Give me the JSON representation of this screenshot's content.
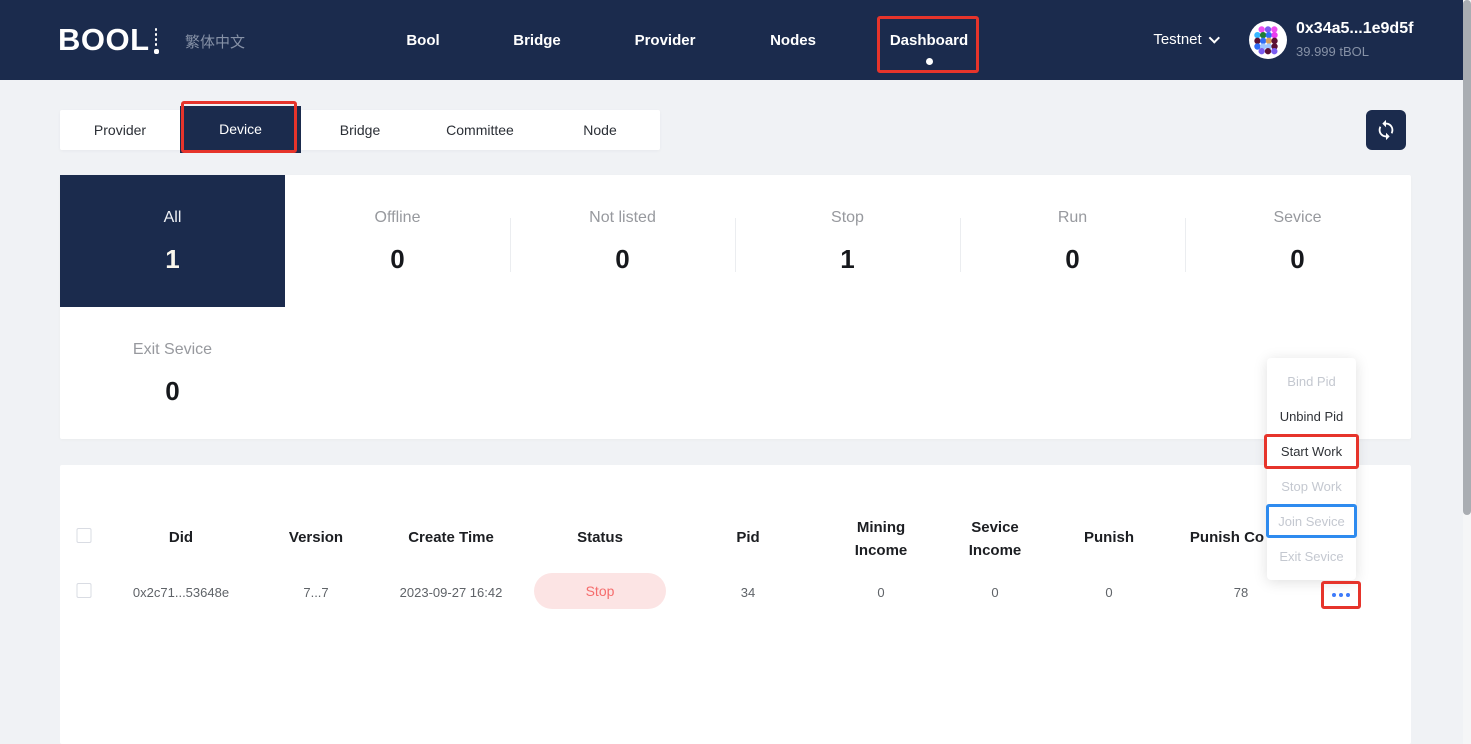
{
  "navbar": {
    "logo": "BOOL",
    "language": "繁体中文",
    "items": [
      {
        "label": "Bool"
      },
      {
        "label": "Bridge"
      },
      {
        "label": "Provider"
      },
      {
        "label": "Nodes"
      },
      {
        "label": "Dashboard",
        "active": true
      }
    ],
    "network": "Testnet",
    "wallet": {
      "address": "0x34a5...1e9d5f",
      "balance": "39.999 tBOL"
    }
  },
  "tabs": {
    "items": [
      "Provider",
      "Device",
      "Bridge",
      "Committee",
      "Node"
    ],
    "active": "Device"
  },
  "stats": {
    "cards": [
      {
        "label": "All",
        "value": "1",
        "selected": true
      },
      {
        "label": "Offline",
        "value": "0"
      },
      {
        "label": "Not listed",
        "value": "0"
      },
      {
        "label": "Stop",
        "value": "1"
      },
      {
        "label": "Run",
        "value": "0"
      },
      {
        "label": "Sevice",
        "value": "0"
      },
      {
        "label": "Exit Sevice",
        "value": "0"
      }
    ]
  },
  "table": {
    "columns": [
      "Did",
      "Version",
      "Create Time",
      "Status",
      "Pid",
      "Mining Income",
      "Sevice Income",
      "Punish",
      "Punish Co"
    ],
    "rows": [
      {
        "did": "0x2c71...53648e",
        "version": "7...7",
        "create_time": "2023-09-27 16:42",
        "status": "Stop",
        "pid": "34",
        "mining_income": "0",
        "sevice_income": "0",
        "punish": "0",
        "punish_count": "78"
      }
    ]
  },
  "menu": {
    "items": [
      {
        "label": "Bind Pid",
        "disabled": true
      },
      {
        "label": "Unbind Pid",
        "disabled": false
      },
      {
        "label": "Start Work",
        "disabled": false,
        "annotation": "red"
      },
      {
        "label": "Stop Work",
        "disabled": true
      },
      {
        "label": "Join Sevice",
        "disabled": true,
        "annotation": "blue"
      },
      {
        "label": "Exit Sevice",
        "disabled": true
      }
    ]
  },
  "colors": {
    "brand_navy": "#1b2b4d",
    "page_background": "#f0f2f5",
    "annotation_red": "#e6342b",
    "annotation_blue": "#2e8bef",
    "status_stop_bg": "#fce4e4",
    "status_stop_text": "#f56c6c",
    "action_dots_blue": "#3e7bfa"
  }
}
